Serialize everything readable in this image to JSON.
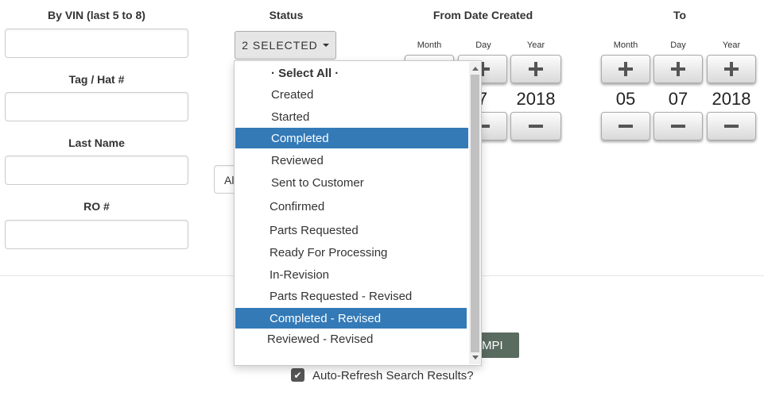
{
  "filters": {
    "vin_label": "By VIN (last 5 to 8)",
    "tag_label": "Tag / Hat #",
    "lastname_label": "Last Name",
    "ro_label": "RO #",
    "status_label": "Status",
    "status_button": "2 SELECTED",
    "hidden_select_text": "Al"
  },
  "date_from": {
    "label": "From Date Created",
    "month_label": "Month",
    "day_label": "Day",
    "year_label": "Year",
    "day_value_partial": "7",
    "year_value": "2018"
  },
  "date_to": {
    "label": "To",
    "month_label": "Month",
    "day_label": "Day",
    "year_label": "Year",
    "month_value": "05",
    "day_value": "07",
    "year_value": "2018"
  },
  "status_options": [
    {
      "label": "· Select All ·",
      "selected": false
    },
    {
      "label": "Created",
      "selected": false
    },
    {
      "label": "Started",
      "selected": false
    },
    {
      "label": "Completed",
      "selected": true
    },
    {
      "label": "Reviewed",
      "selected": false
    },
    {
      "label": "Sent to Customer",
      "selected": false
    },
    {
      "label": "Confirmed",
      "selected": false
    },
    {
      "label": "Parts Requested",
      "selected": false
    },
    {
      "label": "Ready For Processing",
      "selected": false
    },
    {
      "label": "In-Revision",
      "selected": false
    },
    {
      "label": "Parts Requested - Revised",
      "selected": false
    },
    {
      "label": "Completed - Revised",
      "selected": true
    },
    {
      "label": "Reviewed - Revised",
      "selected": false
    }
  ],
  "actions": {
    "mpi_button": "MPI",
    "auto_refresh_label": "Auto-Refresh Search Results?",
    "auto_refresh_checked": true
  },
  "colors": {
    "selected_option": "#337ab7",
    "mpi_button": "#5a6b60"
  }
}
